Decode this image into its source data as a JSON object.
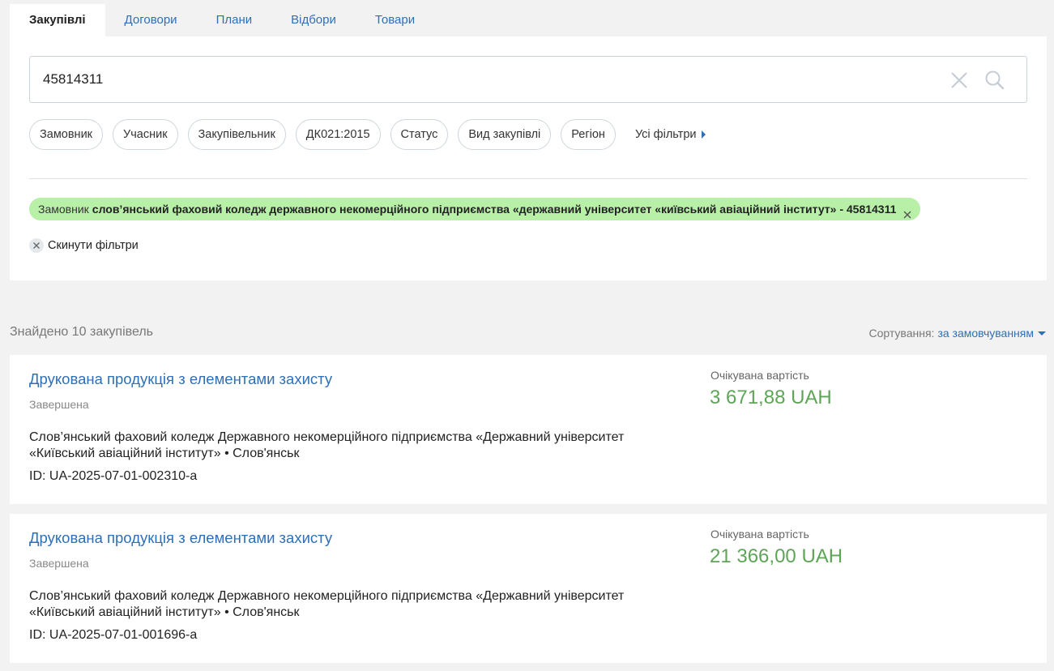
{
  "tabs": [
    {
      "label": "Закупівлі",
      "active": true
    },
    {
      "label": "Договори",
      "active": false
    },
    {
      "label": "Плани",
      "active": false
    },
    {
      "label": "Відбори",
      "active": false
    },
    {
      "label": "Товари",
      "active": false
    }
  ],
  "search": {
    "value": "45814311",
    "clear_icon": "close-icon",
    "search_icon": "search-icon"
  },
  "filter_chips": [
    "Замовник",
    "Учасник",
    "Закупівельник",
    "ДК021:2015",
    "Статус",
    "Вид закупівлі",
    "Регіон"
  ],
  "all_filters_label": "Усі фільтри",
  "active_filter": {
    "label": "Замовник",
    "value": "слов’янський фаховий коледж державного некомерційного підприємства «державний університет «київський авіаційний інститут» - 45814311"
  },
  "reset_label": "Скинути фільтри",
  "results": {
    "found_text": "Знайдено 10 закупівель",
    "sort_label": "Сортування:",
    "sort_value": "за замовчуванням"
  },
  "colors": {
    "accent": "#2f6fb6",
    "price": "#5ea557",
    "active_filter_bg": "#b8f0a8"
  },
  "cards": [
    {
      "title": "Друкована продукція з елементами захисту",
      "status": "Завершена",
      "org": "Слов’янський фаховий коледж Державного некомерційного підприємства «Державний університет «Київський авіаційний інститут» • Слов'янськ",
      "id": "ID: UA-2025-07-01-002310-a",
      "price_label": "Очікувана вартість",
      "price": "3 671,88 UAH"
    },
    {
      "title": "Друкована продукція з елементами захисту",
      "status": "Завершена",
      "org": "Слов’янський фаховий коледж Державного некомерційного підприємства «Державний університет «Київський авіаційний інститут» • Слов'янськ",
      "id": "ID: UA-2025-07-01-001696-a",
      "price_label": "Очікувана вартість",
      "price": "21 366,00 UAH"
    }
  ]
}
